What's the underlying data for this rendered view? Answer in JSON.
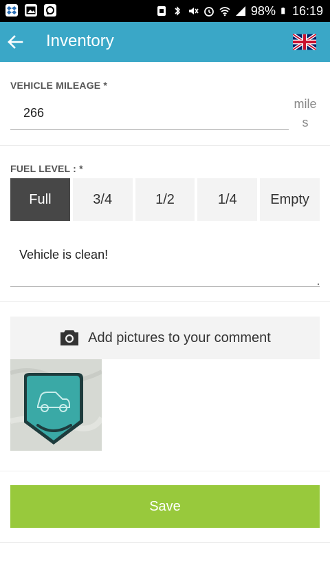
{
  "status_bar": {
    "battery": "98%",
    "time": "16:19",
    "icons": [
      "dropbox-icon",
      "gallery-icon",
      "chat-icon",
      "screenshot-icon",
      "bluetooth-icon",
      "mute-icon",
      "alarm-icon",
      "wifi-icon",
      "signal-icon",
      "battery-icon"
    ]
  },
  "header": {
    "title": "Inventory",
    "back_icon": "arrow-left-icon",
    "language_icon": "uk-flag-icon",
    "color": "#3aa7c7"
  },
  "mileage": {
    "label": "VEHICLE MILEAGE *",
    "value": "266",
    "unit": "miles"
  },
  "fuel": {
    "label": "FUEL LEVEL : *",
    "options": [
      "Full",
      "3/4",
      "1/2",
      "1/4",
      "Empty"
    ],
    "selected": "Full"
  },
  "comment": {
    "value": "Vehicle is clean!"
  },
  "pictures": {
    "add_label": "Add pictures to your comment",
    "icon": "camera-icon",
    "count": 1
  },
  "actions": {
    "save_label": "Save",
    "save_color": "#98c93c"
  }
}
